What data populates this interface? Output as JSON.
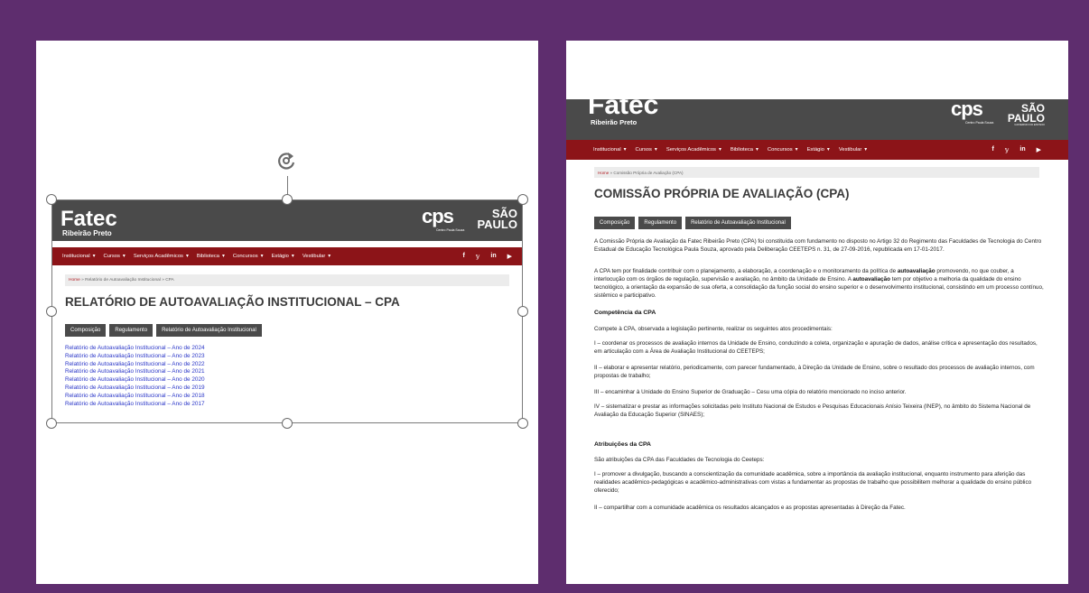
{
  "site": {
    "brand_name": "Fatec",
    "brand_sub": "Ribeirão Preto",
    "logo_cps": "cps",
    "logo_cps_sub": "Centro Paula Souza",
    "logo_sp_top": "SÃO",
    "logo_sp_bottom": "PAULO",
    "logo_sp_sub": "GOVERNO DO ESTADO",
    "nav": [
      "Institucional",
      "Cursos",
      "Serviços Acadêmicos",
      "Biblioteca",
      "Concursos",
      "Estágio",
      "Vestibular"
    ],
    "social_icons": [
      "facebook-icon",
      "twitter-icon",
      "linkedin-icon",
      "youtube-icon"
    ],
    "social_glyphs": [
      "f",
      "𝕪",
      "in",
      "▶"
    ],
    "tabs": [
      "Composição",
      "Regulamento",
      "Relatório de Autoavaliação Institucional"
    ]
  },
  "left": {
    "breadcrumb_home": "Home",
    "breadcrumb_rest": " » Relatório de Autoavaliação Institucional » CPA",
    "title": "RELATÓRIO DE AUTOAVALIAÇÃO INSTITUCIONAL – CPA",
    "links": [
      "Relatório de Autoavaliação Institucional – Ano de 2024",
      "Relatório de Autoavaliação Institucional – Ano de 2023",
      "Relatório de Autoavaliação Institucional – Ano de 2022",
      "Relatório de Autoavaliação Institucional – Ano de 2021",
      "Relatório de Autoavaliação Institucional – Ano de 2020",
      "Relatório de Autoavaliação Institucional – Ano de 2019",
      "Relatório de Autoavaliação Institucional – Ano de 2018",
      "Relatório de Autoavaliação Institucional – Ano de 2017"
    ]
  },
  "right": {
    "breadcrumb_home": "Home",
    "breadcrumb_rest": " » Comissão Própria de Avaliação (CPA)",
    "title": "COMISSÃO PRÓPRIA DE AVALIAÇÃO (CPA)",
    "p1": "A Comissão Própria de Avaliação da Fatec Ribeirão Preto (CPA) foi constituída com fundamento no disposto no Artigo 32 do Regimento das Faculdades de Tecnologia do Centro Estadual de Educação Tecnológica Paula Souza, aprovado pela Deliberação CEETEPS n. 31, de 27-09-2016, republicada em 17-01-2017.",
    "p2_a": "A CPA tem por finalidade contribuir com o planejamento, a elaboração, a coordenação e o monitoramento da política de ",
    "p2_b": "autoavaliação",
    "p2_c": " promovendo, no que couber, a interlocução com os órgãos de regulação, supervisão e avaliação, no âmbito da Unidade de Ensino.  A ",
    "p2_d": "autoavaliação",
    "p2_e": " tem por objetivo a melhoria da qualidade do ensino tecnológico, a orientação da expansão de sua oferta, a consolidação da função social do ensino superior e o desenvolvimento institucional, consistindo em um processo contínuo, sistêmico e participativo.",
    "h_competencia": "Competência da CPA",
    "p3": "Compete à CPA, observada a legislação pertinente, realizar os seguintes atos procedimentais:",
    "p4": "I – coordenar os processos de avaliação internos da Unidade de Ensino, conduzindo a coleta, organização e apuração de dados, análise crítica e apresentação dos resultados, em articulação com a Área de Avaliação Institucional do CEETEPS;",
    "p5": "II – elaborar e apresentar relatório, periodicamente, com parecer fundamentado, à Direção da Unidade de Ensino, sobre o resultado dos processos de avaliação internos, com propostas de trabalho;",
    "p6": "III – encaminhar à Unidade do Ensino Superior de Graduação – Cesu uma cópia do relatório mencionado no inciso anterior.",
    "p7": "IV – sistematizar e prestar as informações solicitadas pelo Instituto Nacional de Estudos e Pesquisas Educacionais Anísio Teixeira (INEP), no âmbito do Sistema Nacional de Avaliação da Educação Superior (SINAES);",
    "h_atribuicoes": "Atribuições da CPA",
    "p8": "São atribuições da CPA das Faculdades de Tecnologia do Ceeteps:",
    "p9": "I – promover a divulgação, buscando a conscientização da comunidade acadêmica, sobre a importância da avaliação institucional, enquanto instrumento para aferição das realidades acadêmico-pedagógicas e acadêmico-administrativas com vistas a fundamentar as propostas de trabalho que possibilitem melhorar a qualidade do ensino público oferecido;",
    "p10": "II – compartilhar com a comunidade acadêmica os resultados alcançados e as propostas apresentadas à Direção da Fatec."
  },
  "colors": {
    "background": "#5e2d6e",
    "header": "#4a4a4a",
    "nav": "#8c1418",
    "link": "#2a36c8"
  }
}
